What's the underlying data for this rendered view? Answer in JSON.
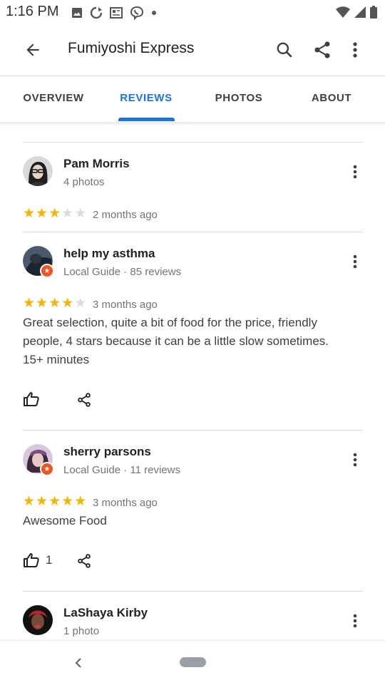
{
  "status_bar": {
    "time": "1:16 PM",
    "icons_left": [
      "photo-icon",
      "sync-icon",
      "news-icon",
      "viber-icon",
      "dot-icon"
    ],
    "icons_right": [
      "wifi-icon",
      "signal-icon",
      "battery-icon"
    ]
  },
  "app_bar": {
    "title": "Fumiyoshi Express"
  },
  "tabs": [
    {
      "label": "OVERVIEW",
      "active": false
    },
    {
      "label": "REVIEWS",
      "active": true
    },
    {
      "label": "PHOTOS",
      "active": false
    },
    {
      "label": "ABOUT",
      "active": false
    }
  ],
  "colors": {
    "accent": "#1a73e8",
    "star": "#f4b400",
    "star_empty": "#dadce0",
    "guide_badge": "#f4511e",
    "secondary_text": "#70757a"
  },
  "reviews": [
    {
      "name": "Pam Morris",
      "meta": "4 photos",
      "rating": 3,
      "max_rating": 5,
      "time": "2 months ago",
      "text": "",
      "likes": "",
      "local_guide": false
    },
    {
      "name": "help my asthma",
      "meta": "Local Guide · 85 reviews",
      "rating": 4,
      "max_rating": 5,
      "time": "3 months ago",
      "text": "Great selection, quite a bit of food for the price, friendly people, 4 stars because it can be a little slow sometimes. 15+ minutes",
      "likes": "",
      "local_guide": true
    },
    {
      "name": "sherry parsons",
      "meta": "Local Guide · 11 reviews",
      "rating": 5,
      "max_rating": 5,
      "time": "3 months ago",
      "text": "Awesome Food",
      "likes": "1",
      "local_guide": true
    },
    {
      "name": "LaShaya Kirby",
      "meta": "1 photo",
      "local_guide": false
    }
  ],
  "nav": {
    "icons": [
      "back-chevron-icon",
      "home-pill-icon"
    ]
  }
}
